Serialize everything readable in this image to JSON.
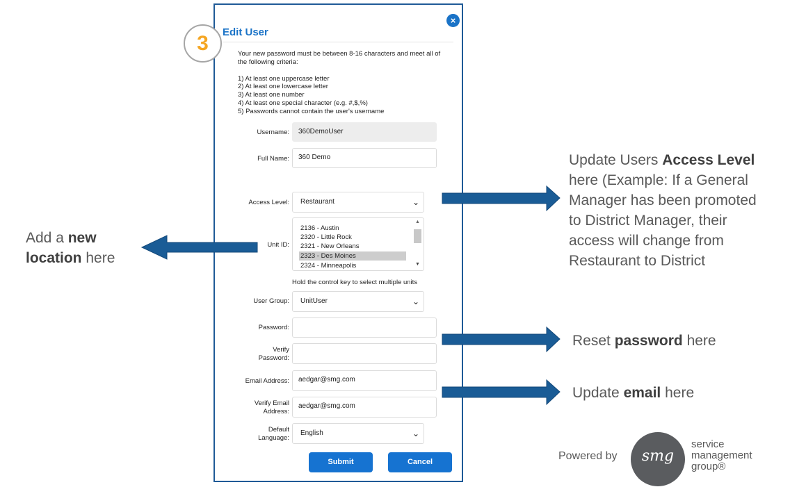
{
  "dialog": {
    "title": "Edit User",
    "step_number": "3",
    "close_icon": "×",
    "rules_intro": "Your new password must be between 8-16 characters and meet all of the following criteria:",
    "rules": [
      "1) At least one uppercase letter",
      "2) At least one lowercase letter",
      "3) At least one number",
      "4) At least one special character (e.g. #,$,%)",
      "5) Passwords cannot contain the user's username"
    ],
    "fields": {
      "username": {
        "label": "Username:",
        "value": "360DemoUser"
      },
      "full_name": {
        "label": "Full Name:",
        "value": "360 Demo"
      },
      "access_level": {
        "label": "Access Level:",
        "value": "Restaurant"
      },
      "unit_id": {
        "label": "Unit ID:",
        "options": [
          "2136 - Austin",
          "2320 - Little Rock",
          "2321 - New Orleans",
          "2323 - Des Moines",
          "2324 - Minneapolis"
        ],
        "selected": "2323 - Des Moines",
        "hint": "Hold the control key to select multiple units"
      },
      "user_group": {
        "label": "User Group:",
        "value": "UnitUser"
      },
      "password": {
        "label": "Password:",
        "value": ""
      },
      "verify_password": {
        "label_line1": "Verify",
        "label_line2": "Password:",
        "value": ""
      },
      "email": {
        "label": "Email Address:",
        "value": "aedgar@smg.com"
      },
      "verify_email": {
        "label_line1": "Verify Email",
        "label_line2": "Address:",
        "value": "aedgar@smg.com"
      },
      "language": {
        "label_line1": "Default",
        "label_line2": "Language:",
        "value": "English"
      }
    },
    "submit_label": "Submit",
    "cancel_label": "Cancel"
  },
  "callouts": {
    "new_location": {
      "pre": "Add a ",
      "bold1": "new",
      "bold2": "location",
      "post": " here"
    },
    "access_level": {
      "pre": "Update Users ",
      "bold": "Access Level",
      "line2": "here (Example: If a General",
      "line3": "Manager has been promoted",
      "line4": "to District Manager, their",
      "line5": "access will change from",
      "line6": "Restaurant to District"
    },
    "password": {
      "pre": "Reset ",
      "bold": "password",
      "post": " here"
    },
    "email": {
      "pre": "Update ",
      "bold": "email",
      "post": " here"
    }
  },
  "footer": {
    "powered_by": "Powered by",
    "logo_text": "smg",
    "company_line1": "service",
    "company_line2": "management",
    "company_line3": "group®"
  },
  "colors": {
    "accent": "#1673d1",
    "arrow": "#1a5c96",
    "badge_number": "#f5a623",
    "callout_text": "#595959"
  }
}
